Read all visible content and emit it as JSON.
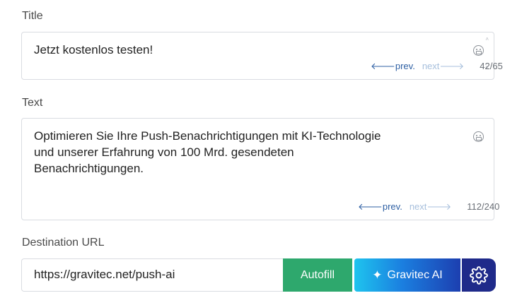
{
  "title_section": {
    "label": "Title",
    "value": "Jetzt kostenlos testen!",
    "prev_label": "prev.",
    "next_label": "next",
    "counter": "42/65"
  },
  "text_section": {
    "label": "Text",
    "lines": [
      "Optimieren Sie Ihre Push-Benachrichtigungen mit KI-Technologie",
      "und unserer Erfahrung von 100 Mrd. gesendeten",
      "Benachrichtigungen."
    ],
    "prev_label": "prev.",
    "next_label": "next",
    "counter": "112/240"
  },
  "url_section": {
    "label": "Destination URL",
    "value": "https://gravitec.net/push-ai",
    "autofill_label": "Autofill",
    "ai_label": "Gravitec AI"
  },
  "icons": {
    "emoji": "emoji-icon",
    "sparkle": "sparkle-icon",
    "settings": "gear-icon"
  },
  "colors": {
    "autofill": "#2ea86d",
    "ai_gradient_start": "#1ec4ee",
    "ai_gradient_end": "#1c3fb0",
    "settings": "#1f2a8a",
    "prev_link": "#2d5fa3",
    "next_link": "#a7bfdc"
  }
}
